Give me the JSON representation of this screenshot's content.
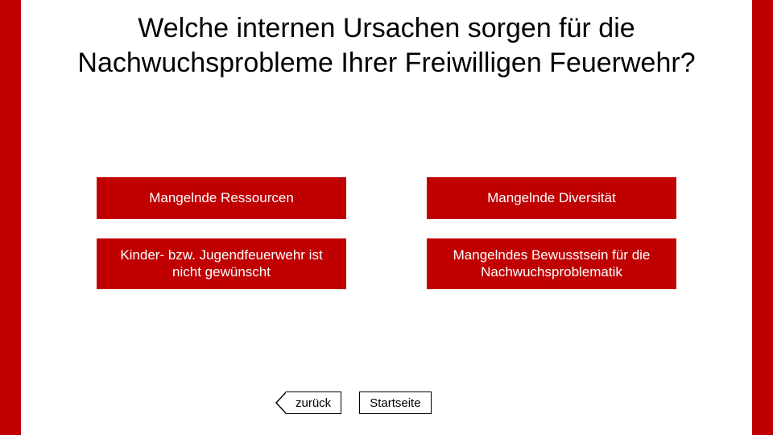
{
  "title": "Welche internen Ursachen sorgen für die Nachwuchsprobleme Ihrer Freiwilligen Feuerwehr?",
  "options": [
    "Mangelnde Ressourcen",
    "Mangelnde Diversität",
    "Kinder- bzw. Jugendfeuerwehr ist nicht gewünscht",
    "Mangelndes Bewusstsein für die Nachwuchsproblematik"
  ],
  "nav": {
    "back": "zurück",
    "home": "Startseite"
  },
  "colors": {
    "accent": "#c00000"
  }
}
